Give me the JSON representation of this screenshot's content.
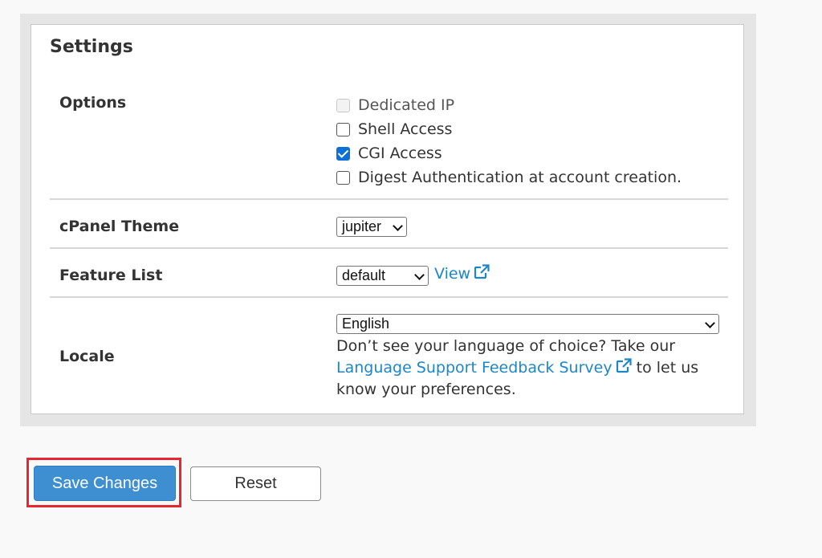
{
  "settings": {
    "title": "Settings",
    "options": {
      "label": "Options",
      "items": [
        {
          "label": "Dedicated IP",
          "checked": false,
          "disabled": true
        },
        {
          "label": "Shell Access",
          "checked": false,
          "disabled": false
        },
        {
          "label": "CGI Access",
          "checked": true,
          "disabled": false
        },
        {
          "label": "Digest Authentication at account creation.",
          "checked": false,
          "disabled": false
        }
      ]
    },
    "theme": {
      "label": "cPanel Theme",
      "selected": "jupiter"
    },
    "feature_list": {
      "label": "Feature List",
      "selected": "default",
      "view_link": "View"
    },
    "locale": {
      "label": "Locale",
      "selected": "English",
      "help_prefix": "Don’t see your language of choice? Take our",
      "survey_link": "Language Support Feedback Survey",
      "help_suffix": "to let us know your preferences."
    }
  },
  "actions": {
    "save_label": "Save Changes",
    "reset_label": "Reset"
  },
  "colors": {
    "accent": "#3e8ed2",
    "link": "#1b87c9",
    "highlight": "#e8262d",
    "checkbox_checked": "#0d6fd8"
  }
}
